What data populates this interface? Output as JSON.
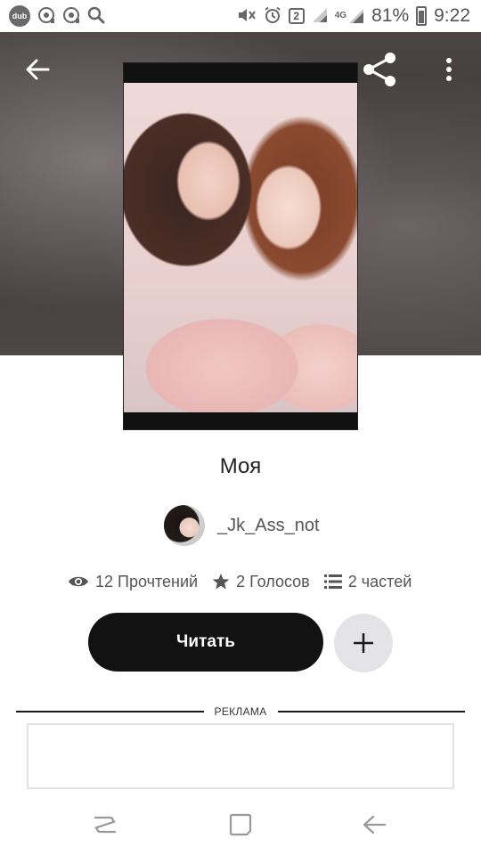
{
  "status_bar": {
    "app_badge": "dub",
    "sim_badge": "2",
    "network": "4G",
    "battery_percent": "81%",
    "time": "9:22",
    "left_icons": [
      "dub-icon",
      "alarm-clock-icon",
      "alarm-clock-icon",
      "search-icon"
    ],
    "right_icons": [
      "mute-icon",
      "alarm-icon",
      "sim-2-icon",
      "signal-icon",
      "4g-signal-icon",
      "battery-icon"
    ]
  },
  "header": {
    "back_icon": "arrow-back-icon",
    "share_icon": "share-icon",
    "more_icon": "more-vertical-icon"
  },
  "story": {
    "title": "Моя",
    "author": "_Jk_Ass_not"
  },
  "stats": {
    "reads": "12 Прочтений",
    "votes": "2 Голосов",
    "parts": "2 частей"
  },
  "actions": {
    "read_label": "Читать",
    "add_icon": "plus-icon"
  },
  "ad": {
    "label": "РЕКЛАМА"
  },
  "nav_bar": {
    "icons": [
      "recents-icon",
      "home-icon",
      "back-icon"
    ]
  },
  "colors": {
    "primary_button": "#121212",
    "secondary_button": "#e4e4e6",
    "header_bg": "#423c3b",
    "text": "#222222",
    "muted_text": "#555555"
  }
}
